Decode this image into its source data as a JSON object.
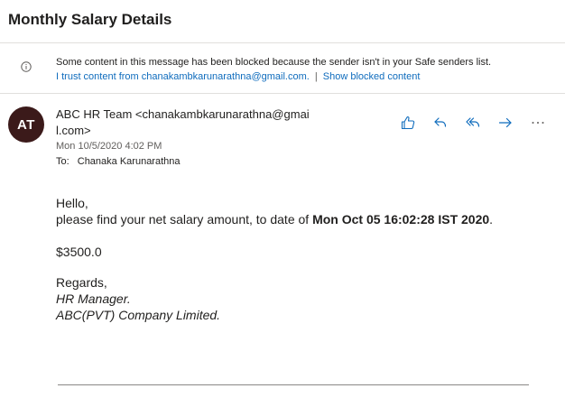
{
  "email": {
    "subject": "Monthly Salary Details",
    "info_bar": {
      "message": "Some content in this message has been blocked because the sender isn't in your Safe senders list.",
      "trust_link": "I trust content from chanakambkarunarathna@gmail.com.",
      "separator": "|",
      "show_blocked_link": "Show blocked content"
    },
    "avatar_initials": "AT",
    "sender": "ABC HR Team <chanakambkarunarathna@gmail.com>",
    "date": "Mon 10/5/2020 4:02 PM",
    "to_label": "To:",
    "to_value": "Chanaka Karunarathna",
    "actions": [
      {
        "name": "like",
        "icon": "thumbs-up-icon"
      },
      {
        "name": "reply",
        "icon": "reply-icon"
      },
      {
        "name": "reply-all",
        "icon": "reply-all-icon"
      },
      {
        "name": "forward",
        "icon": "forward-icon"
      },
      {
        "name": "more",
        "icon": "more-icon"
      }
    ],
    "body": {
      "greeting": "Hello,",
      "line_prefix": "please find your net salary amount, to date of ",
      "line_date": "Mon Oct 05 16:02:28 IST 2020",
      "line_suffix": ".",
      "amount": "$3500.0",
      "regards": "Regards,",
      "signature_title": "HR Manager.",
      "signature_company": "ABC(PVT) Company Limited."
    }
  },
  "colors": {
    "link": "#0f6cbd",
    "avatar_bg": "#3b1a1a",
    "icon": "#0f6cbd"
  }
}
